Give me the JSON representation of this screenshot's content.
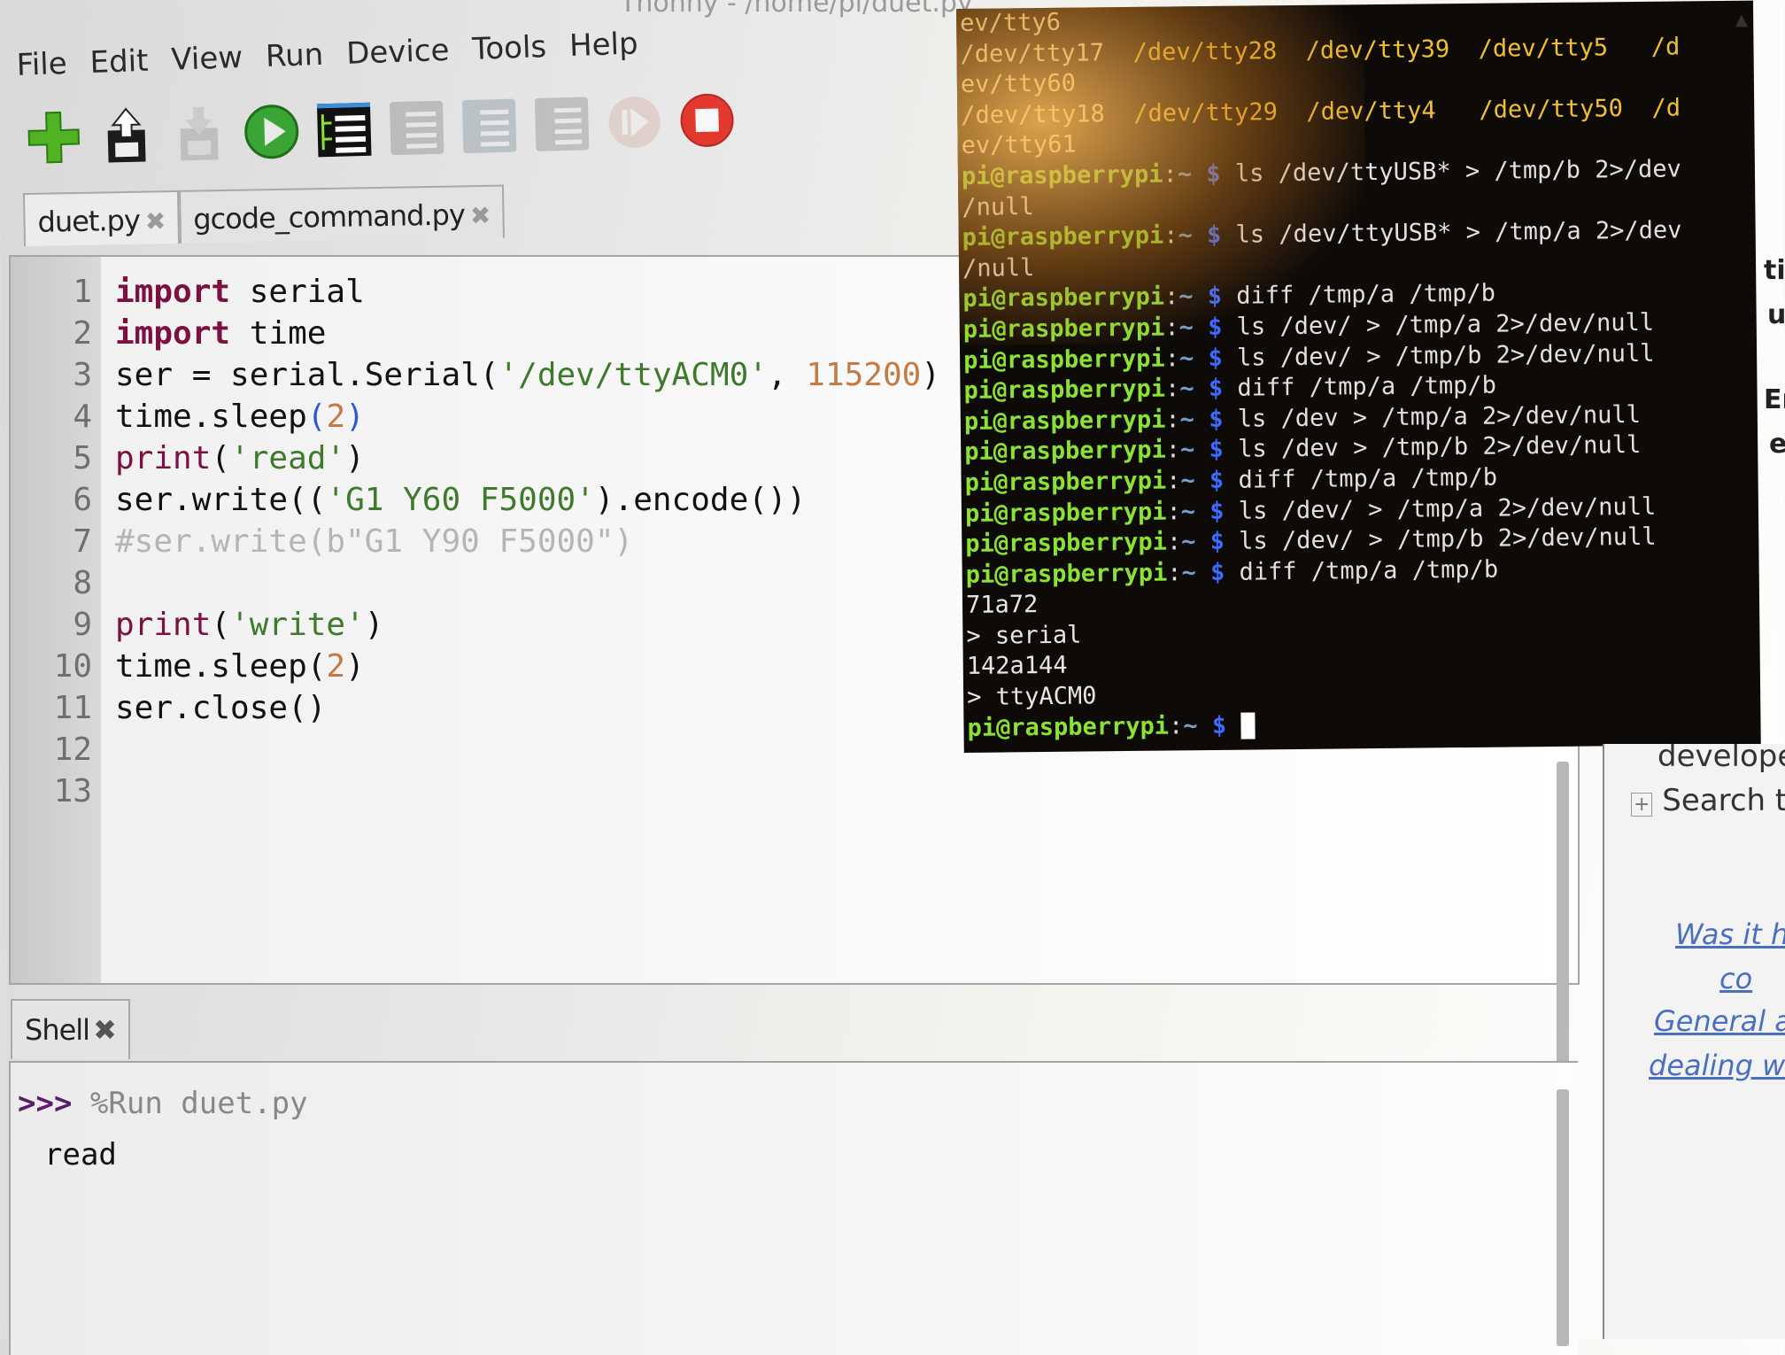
{
  "window": {
    "title_fragment": "Thonny  -  /home/pi/duet.py"
  },
  "menu": [
    "File",
    "Edit",
    "View",
    "Run",
    "Device",
    "Tools",
    "Help"
  ],
  "toolbar": [
    {
      "name": "new",
      "icon": "plus-icon",
      "enabled": true
    },
    {
      "name": "load",
      "icon": "open-icon",
      "enabled": true
    },
    {
      "name": "save",
      "icon": "save-icon",
      "enabled": false
    },
    {
      "name": "run",
      "icon": "run-icon",
      "enabled": true
    },
    {
      "name": "debug",
      "icon": "debug-icon",
      "enabled": true
    },
    {
      "name": "step-over",
      "icon": "step-over-icon",
      "enabled": false
    },
    {
      "name": "step-into",
      "icon": "step-into-icon",
      "enabled": false
    },
    {
      "name": "step-out",
      "icon": "step-out-icon",
      "enabled": false
    },
    {
      "name": "resume",
      "icon": "resume-icon",
      "enabled": false
    },
    {
      "name": "stop",
      "icon": "stop-icon",
      "enabled": true
    }
  ],
  "editor_tabs": [
    {
      "label": "duet.py",
      "active": true
    },
    {
      "label": "gcode_command.py",
      "active": false
    }
  ],
  "code": {
    "line_numbers": [
      "1",
      "2",
      "3",
      "4",
      "5",
      "6",
      "7",
      "8",
      "9",
      "10",
      "11",
      "12",
      "13"
    ],
    "lines": [
      [
        {
          "t": "import",
          "c": "kw"
        },
        {
          "t": " serial",
          "c": "txt"
        }
      ],
      [
        {
          "t": "import",
          "c": "kw"
        },
        {
          "t": " time",
          "c": "txt"
        }
      ],
      [
        {
          "t": "ser = serial.Serial(",
          "c": "txt"
        },
        {
          "t": "'/dev/ttyACM0'",
          "c": "str"
        },
        {
          "t": ", ",
          "c": "txt"
        },
        {
          "t": "115200",
          "c": "num"
        },
        {
          "t": ")",
          "c": "txt"
        }
      ],
      [
        {
          "t": "time.sleep",
          "c": "txt"
        },
        {
          "t": "(",
          "c": "par"
        },
        {
          "t": "2",
          "c": "num"
        },
        {
          "t": ")",
          "c": "par"
        }
      ],
      [
        {
          "t": "print",
          "c": "fn"
        },
        {
          "t": "(",
          "c": "txt"
        },
        {
          "t": "'read'",
          "c": "str"
        },
        {
          "t": ")",
          "c": "txt"
        }
      ],
      [
        {
          "t": "ser.write((",
          "c": "txt"
        },
        {
          "t": "'G1 Y60 F5000'",
          "c": "str"
        },
        {
          "t": ").encode())",
          "c": "txt"
        }
      ],
      [
        {
          "t": "#ser.write(b\"G1 Y90 F5000\")",
          "c": "cmt"
        }
      ],
      [],
      [
        {
          "t": "print",
          "c": "fn"
        },
        {
          "t": "(",
          "c": "txt"
        },
        {
          "t": "'write'",
          "c": "str"
        },
        {
          "t": ")",
          "c": "txt"
        }
      ],
      [
        {
          "t": "time.sleep(",
          "c": "txt"
        },
        {
          "t": "2",
          "c": "num"
        },
        {
          "t": ")",
          "c": "txt"
        }
      ],
      [
        {
          "t": "ser.close()",
          "c": "txt"
        }
      ],
      [],
      []
    ]
  },
  "shell": {
    "tab_label": "Shell",
    "prompt": ">>>",
    "command": "%Run duet.py",
    "output": "read"
  },
  "terminal": {
    "user_host": "pi@raspberrypi",
    "cwd": "~",
    "dollar": "$",
    "lines": [
      {
        "type": "faded",
        "text": "ev/tty6"
      },
      {
        "type": "cols",
        "first": "/dev/tty17",
        "rest": "  /dev/tty28  /dev/tty39  /dev/tty5   /d"
      },
      {
        "type": "faded",
        "text": "ev/tty60"
      },
      {
        "type": "cols",
        "first": "/dev/tty18",
        "rest": "  /dev/tty29  /dev/tty4   /dev/tty50  /d"
      },
      {
        "type": "faded",
        "text": "ev/tty61"
      },
      {
        "type": "prompt",
        "cmd": "ls /dev/ttyUSB* > /tmp/b 2>/dev"
      },
      {
        "type": "plain",
        "text": "/null"
      },
      {
        "type": "prompt",
        "cmd": "ls /dev/ttyUSB* > /tmp/a 2>/dev"
      },
      {
        "type": "plain",
        "text": "/null"
      },
      {
        "type": "prompt",
        "cmd": "diff /tmp/a /tmp/b"
      },
      {
        "type": "prompt",
        "cmd": "ls /dev/ > /tmp/a 2>/dev/null"
      },
      {
        "type": "prompt",
        "cmd": "ls /dev/ > /tmp/b 2>/dev/null"
      },
      {
        "type": "prompt",
        "cmd": "diff /tmp/a /tmp/b"
      },
      {
        "type": "prompt",
        "cmd": "ls /dev > /tmp/a 2>/dev/null"
      },
      {
        "type": "prompt",
        "cmd": "ls /dev > /tmp/b 2>/dev/null"
      },
      {
        "type": "prompt",
        "cmd": "diff /tmp/a /tmp/b"
      },
      {
        "type": "prompt",
        "cmd": "ls /dev/ > /tmp/a 2>/dev/null"
      },
      {
        "type": "prompt",
        "cmd": "ls /dev/ > /tmp/b 2>/dev/null"
      },
      {
        "type": "prompt",
        "cmd": "diff /tmp/a /tmp/b"
      },
      {
        "type": "plain",
        "text": "71a72"
      },
      {
        "type": "plain",
        "text": "> serial"
      },
      {
        "type": "plain",
        "text": "142a144"
      },
      {
        "type": "plain",
        "text": "> ttyACM0"
      },
      {
        "type": "prompt",
        "cmd": "",
        "cursor": true
      }
    ]
  },
  "browser": {
    "fragments": [
      "ti",
      "u",
      "Er",
      "e"
    ],
    "text_developer": "developer",
    "search_text": "Search th",
    "links": [
      "Was it he",
      "co",
      "General ac",
      "dealing wit"
    ]
  }
}
